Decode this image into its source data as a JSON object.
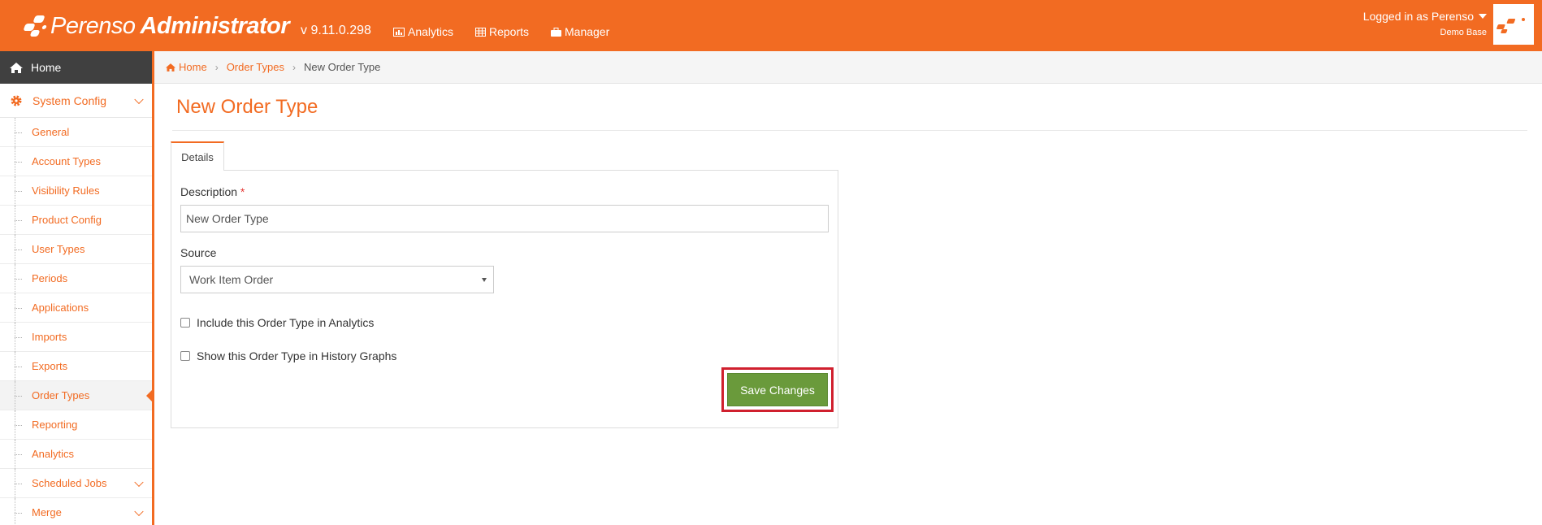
{
  "header": {
    "brand_name": "Perenso",
    "brand_suffix": "Administrator",
    "version": "v 9.11.0.298",
    "nav": [
      {
        "label": "Analytics",
        "icon": "chart-icon"
      },
      {
        "label": "Reports",
        "icon": "table-icon"
      },
      {
        "label": "Manager",
        "icon": "briefcase-icon"
      }
    ],
    "user_text": "Logged in as Perenso",
    "user_sub": "Demo Base"
  },
  "sidebar": {
    "home": "Home",
    "config": "System Config",
    "items": [
      {
        "label": "General"
      },
      {
        "label": "Account Types"
      },
      {
        "label": "Visibility Rules"
      },
      {
        "label": "Product Config"
      },
      {
        "label": "User Types"
      },
      {
        "label": "Periods"
      },
      {
        "label": "Applications"
      },
      {
        "label": "Imports"
      },
      {
        "label": "Exports"
      },
      {
        "label": "Order Types",
        "active": true
      },
      {
        "label": "Reporting"
      },
      {
        "label": "Analytics"
      },
      {
        "label": "Scheduled Jobs",
        "expandable": true
      },
      {
        "label": "Merge",
        "expandable": true
      }
    ]
  },
  "breadcrumb": {
    "home": "Home",
    "section": "Order Types",
    "current": "New Order Type"
  },
  "page": {
    "title": "New Order Type",
    "tab": "Details",
    "description_label": "Description",
    "required_mark": "*",
    "description_value": "New Order Type",
    "source_label": "Source",
    "source_value": "Work Item Order",
    "analytics_checkbox": "Include this Order Type in Analytics",
    "analytics_checked": false,
    "history_checkbox": "Show this Order Type in History Graphs",
    "history_checked": false,
    "save_label": "Save Changes"
  },
  "colors": {
    "brand": "#f26b22",
    "save": "#6a9a3b",
    "highlight": "#d0202e",
    "sidebar_home": "#404040"
  }
}
